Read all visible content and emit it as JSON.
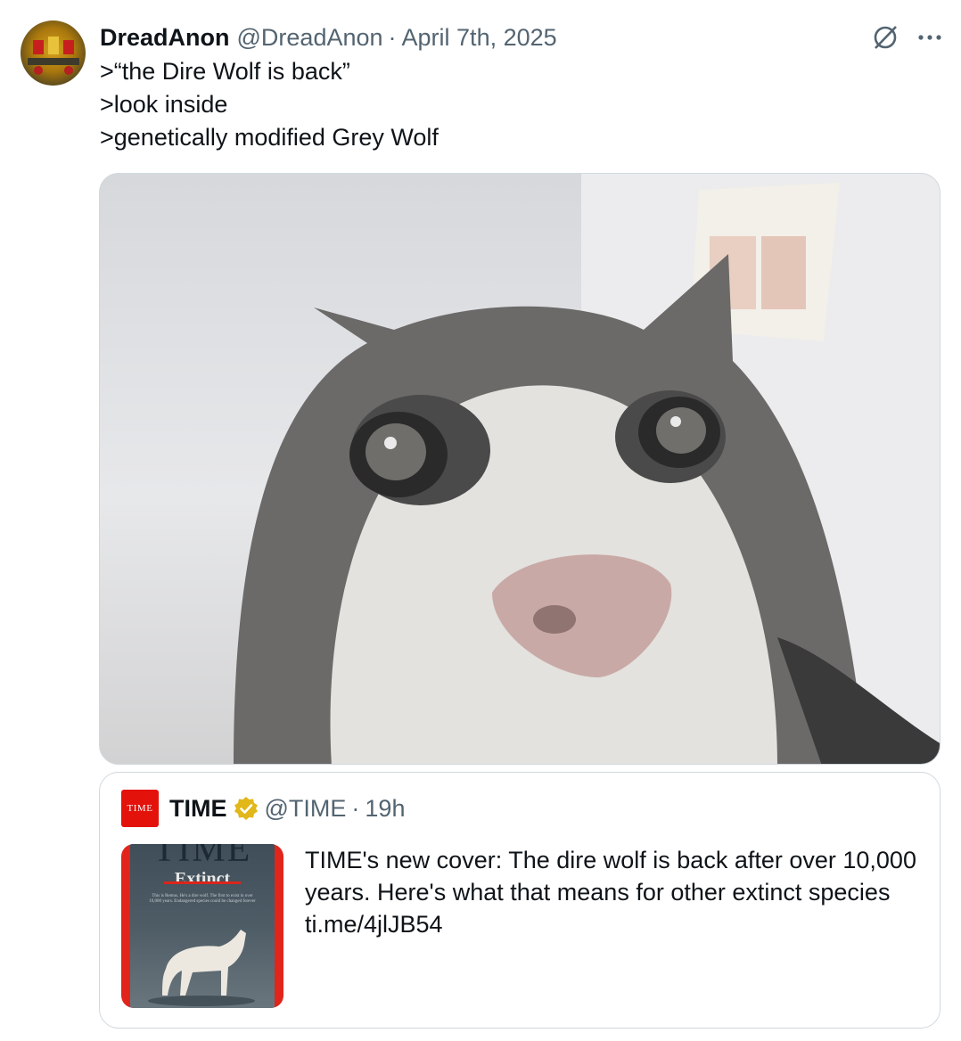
{
  "tweet": {
    "display_name": "DreadAnon",
    "handle": "@DreadAnon",
    "separator": "·",
    "date": "April 7th, 2025",
    "text": ">“the Dire Wolf is back”\n>look inside\n>genetically modified Grey Wolf",
    "avatar_icon": "avatar-image",
    "grok_icon": "grok-icon",
    "more_icon": "more-icon",
    "media_icon": "cat-photo"
  },
  "quoted_tweet": {
    "logo_text": "TIME",
    "display_name": "TIME",
    "handle": "@TIME",
    "separator": "·",
    "time": "19h",
    "text": "TIME's new cover: The dire wolf is back after over 10,000 years. Here's what that means for other extinct species ti.me/4jlJB54",
    "cover": {
      "masthead": "TIME",
      "headline": "Extinct",
      "blurb": "This is Remus. He's a dire wolf. The first to exist in over 10,000 years. Endangered species could be changed forever"
    },
    "verified_color": "#e2b719"
  },
  "colors": {
    "text": "#0f1419",
    "muted": "#536471",
    "border": "#cfd9de",
    "time_red": "#e3120b"
  }
}
